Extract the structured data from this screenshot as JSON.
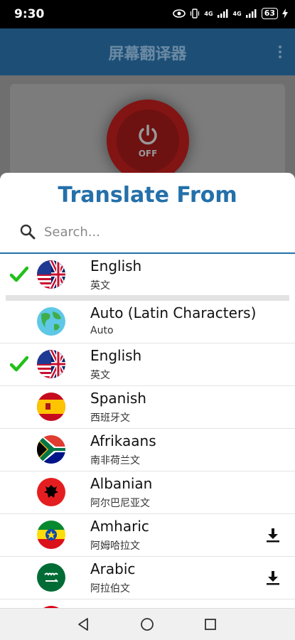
{
  "status_bar": {
    "time": "9:30",
    "battery": "63",
    "net1": "4G",
    "net2": "4G"
  },
  "app_bar": {
    "title": "屏幕翻译器"
  },
  "power_button": {
    "state_label": "OFF"
  },
  "sheet": {
    "title": "Translate From",
    "search": {
      "placeholder": "Search..."
    }
  },
  "selected_language": {
    "name": "English",
    "native": "英文",
    "flag": "us-uk-flag",
    "checked": true
  },
  "languages": [
    {
      "name": "Auto (Latin Characters)",
      "native": "Auto",
      "flag": "globe-flag",
      "checked": false,
      "download": false
    },
    {
      "name": "English",
      "native": "英文",
      "flag": "us-uk-flag",
      "checked": true,
      "download": false
    },
    {
      "name": "Spanish",
      "native": "西班牙文",
      "flag": "spain-flag",
      "checked": false,
      "download": false
    },
    {
      "name": "Afrikaans",
      "native": "南非荷兰文",
      "flag": "south-africa-flag",
      "checked": false,
      "download": false
    },
    {
      "name": "Albanian",
      "native": "阿尔巴尼亚文",
      "flag": "albania-flag",
      "checked": false,
      "download": false
    },
    {
      "name": "Amharic",
      "native": "阿姆哈拉文",
      "flag": "ethiopia-flag",
      "checked": false,
      "download": true
    },
    {
      "name": "Arabic",
      "native": "阿拉伯文",
      "flag": "saudi-arabia-flag",
      "checked": false,
      "download": true
    }
  ],
  "colors": {
    "accent": "#2470aa",
    "check": "#22c01a",
    "appbar": "#1d4f76"
  }
}
